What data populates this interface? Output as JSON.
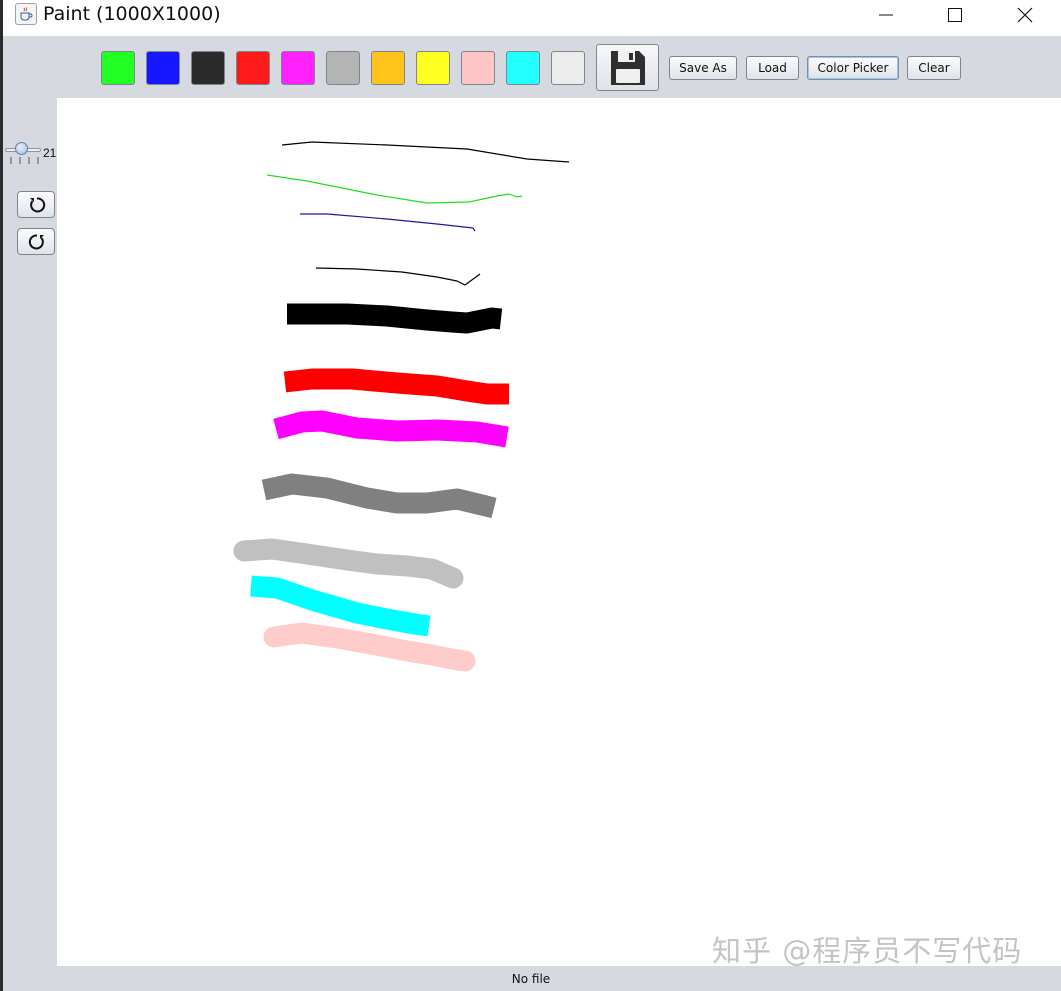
{
  "window": {
    "title": "Paint (1000X1000)",
    "app_icon": "java-coffee-cup-icon",
    "controls": [
      "minimize-icon",
      "maximize-icon",
      "close-icon"
    ]
  },
  "toolbar": {
    "colors": [
      {
        "name": "green",
        "hex": "#22ff22"
      },
      {
        "name": "blue",
        "hex": "#1616ff"
      },
      {
        "name": "black",
        "hex": "#2a2a2a"
      },
      {
        "name": "red",
        "hex": "#ff1a1a"
      },
      {
        "name": "magenta",
        "hex": "#ff22ff"
      },
      {
        "name": "gray",
        "hex": "#b4b4b4"
      },
      {
        "name": "orange",
        "hex": "#ffc31a"
      },
      {
        "name": "yellow",
        "hex": "#ffff22"
      },
      {
        "name": "pink",
        "hex": "#ffc4c4"
      },
      {
        "name": "cyan",
        "hex": "#22ffff"
      },
      {
        "name": "white",
        "hex": "#ececec"
      }
    ],
    "save_icon": "floppy-disk-icon",
    "save_as_label": "Save As",
    "load_label": "Load",
    "color_picker_label": "Color Picker",
    "clear_label": "Clear"
  },
  "side": {
    "brush_size": "21",
    "undo_icon": "undo-icon",
    "redo_icon": "redo-icon"
  },
  "canvas": {
    "watermark": "知乎 @程序员不写代码",
    "strokes": [
      {
        "color": "#000000",
        "kind": "thin"
      },
      {
        "color": "#22dd22",
        "kind": "thin"
      },
      {
        "color": "#1a1a9a",
        "kind": "thin"
      },
      {
        "color": "#000000",
        "kind": "thin"
      },
      {
        "color": "#000000",
        "kind": "thick"
      },
      {
        "color": "#ff0000",
        "kind": "thick"
      },
      {
        "color": "#ff00ff",
        "kind": "thick"
      },
      {
        "color": "#808080",
        "kind": "thick"
      },
      {
        "color": "#c0c0c0",
        "kind": "thick"
      },
      {
        "color": "#00ffff",
        "kind": "thick"
      },
      {
        "color": "#ffcccc",
        "kind": "thick"
      }
    ]
  },
  "status": {
    "text": "No file"
  }
}
